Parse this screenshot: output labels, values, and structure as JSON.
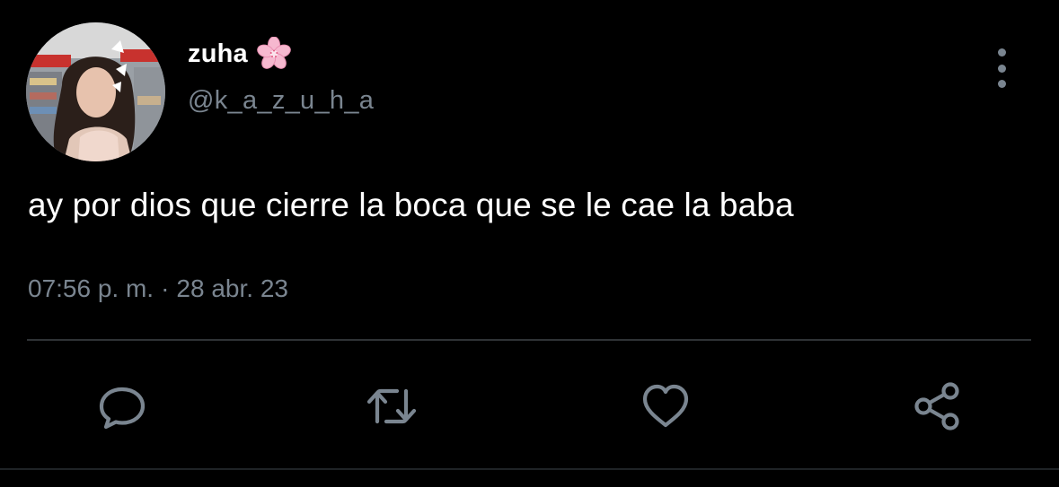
{
  "tweet": {
    "author": {
      "display_name": "zuha",
      "name_emoji_icon": "cherry-blossom-icon",
      "handle": "@k_a_z_u_h_a"
    },
    "text": "ay por dios que cierre la boca que se le cae la baba",
    "time": "07:56 p. m.",
    "separator": "·",
    "date": "28 abr. 23"
  },
  "actions": [
    {
      "name": "reply",
      "icon": "comment-icon"
    },
    {
      "name": "retweet",
      "icon": "retweet-icon"
    },
    {
      "name": "like",
      "icon": "heart-icon"
    },
    {
      "name": "share",
      "icon": "share-icon"
    }
  ],
  "more_icon": "more-vertical-icon",
  "colors": {
    "background": "#000000",
    "primary_text": "#ffffff",
    "secondary_text": "#7a8590",
    "divider": "#2f3336",
    "flower_pink": "#f6b8cf"
  }
}
